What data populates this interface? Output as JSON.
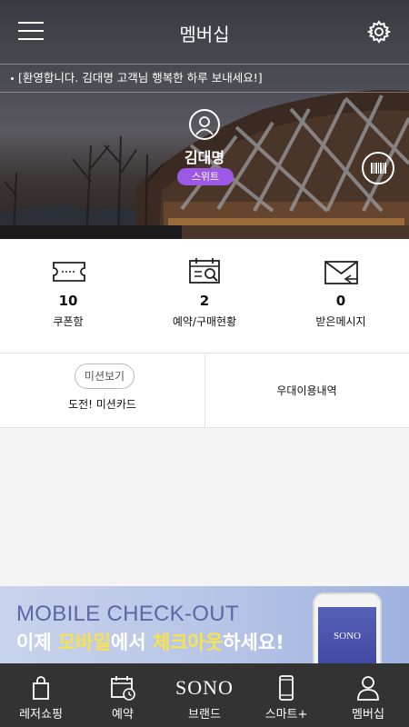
{
  "header": {
    "title": "멤버십",
    "notice": "[환영합니다. 김대명 고객님 행복한 하루 보내세요!]"
  },
  "profile": {
    "name": "김대명",
    "grade": "스위트"
  },
  "stats": [
    {
      "value": "10",
      "label": "쿠폰함",
      "icon": "ticket-icon"
    },
    {
      "value": "2",
      "label": "예약/구매현황",
      "icon": "reservation-search-icon"
    },
    {
      "value": "0",
      "label": "받은메시지",
      "icon": "mail-icon"
    }
  ],
  "mission": {
    "button_label": "미션보기",
    "card_label": "도전! 미션카드",
    "benefit_label": "우대이용내역"
  },
  "banner": {
    "line1": "MOBILE CHECK-OUT",
    "line2_pre": "이제 ",
    "line2_hl1": "모바일",
    "line2_mid": "에서 ",
    "line2_hl2": "체크아웃",
    "line2_post": "하세요!",
    "phone_logo": "SONO"
  },
  "bottom_nav": [
    {
      "label": "레저쇼핑",
      "icon": "shopping-bag-icon"
    },
    {
      "label": "예약",
      "icon": "calendar-icon"
    },
    {
      "label": "브랜드",
      "logo": "SONO"
    },
    {
      "label": "스마트+",
      "icon": "smartphone-icon"
    },
    {
      "label": "멤버십",
      "icon": "person-icon"
    }
  ],
  "colors": {
    "badge": "#9b59e6",
    "nav_bg": "#333333",
    "banner_highlight": "#f8e34a"
  }
}
